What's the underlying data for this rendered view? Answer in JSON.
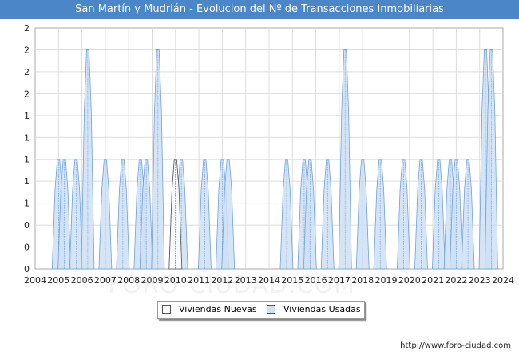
{
  "chart_data": {
    "type": "area",
    "title": "San Martín y Mudrián - Evolucion del Nº de Transacciones Inmobiliarias",
    "xlabel": "",
    "ylabel": "",
    "x_tick_labels": [
      "2004",
      "2005",
      "2006",
      "2007",
      "2008",
      "2009",
      "2010",
      "2011",
      "2012",
      "2013",
      "2014",
      "2015",
      "2016",
      "2017",
      "2018",
      "2019",
      "2020",
      "2021",
      "2022",
      "2023",
      "2024"
    ],
    "y_tick_labels": [
      "0",
      "0",
      "0",
      "1",
      "1",
      "1",
      "1",
      "1",
      "2",
      "2",
      "2",
      "2"
    ],
    "ylim": [
      0,
      2.2
    ],
    "grid": true,
    "legend_position": "bottom",
    "x_range": [
      2004,
      2024
    ],
    "series": [
      {
        "name": "Viviendas Nuevas",
        "color": "#ffffff",
        "points": [
          [
            2010.0,
            1.0
          ]
        ]
      },
      {
        "name": "Viviendas Usadas",
        "color": "#cfe0f5",
        "points": [
          [
            2005.0,
            1
          ],
          [
            2005.25,
            1
          ],
          [
            2005.75,
            1
          ],
          [
            2006.25,
            2
          ],
          [
            2007.0,
            1
          ],
          [
            2007.75,
            1
          ],
          [
            2008.5,
            1
          ],
          [
            2008.75,
            1
          ],
          [
            2009.25,
            2
          ],
          [
            2010.0,
            1
          ],
          [
            2010.25,
            1
          ],
          [
            2011.25,
            1
          ],
          [
            2012.0,
            1
          ],
          [
            2012.25,
            1
          ],
          [
            2014.75,
            1
          ],
          [
            2015.5,
            1
          ],
          [
            2015.75,
            1
          ],
          [
            2016.5,
            1
          ],
          [
            2017.25,
            2
          ],
          [
            2018.0,
            1
          ],
          [
            2018.75,
            1
          ],
          [
            2019.75,
            1
          ],
          [
            2020.5,
            1
          ],
          [
            2021.25,
            1
          ],
          [
            2021.75,
            1
          ],
          [
            2022.0,
            1
          ],
          [
            2022.5,
            1
          ],
          [
            2023.25,
            2
          ],
          [
            2023.5,
            2
          ]
        ]
      }
    ]
  },
  "legend": {
    "nuevas_label": "Viviendas Nuevas",
    "usadas_label": "Viviendas Usadas"
  },
  "source_text": "http://www.foro-ciudad.com",
  "watermark_text": "FORO-CIUDAD.COM",
  "colors": {
    "title_bg": "#4a86c8",
    "usadas_fill": "#cfe0f5",
    "usadas_stroke": "#6fa0dd",
    "nuevas_stroke": "#555555"
  }
}
